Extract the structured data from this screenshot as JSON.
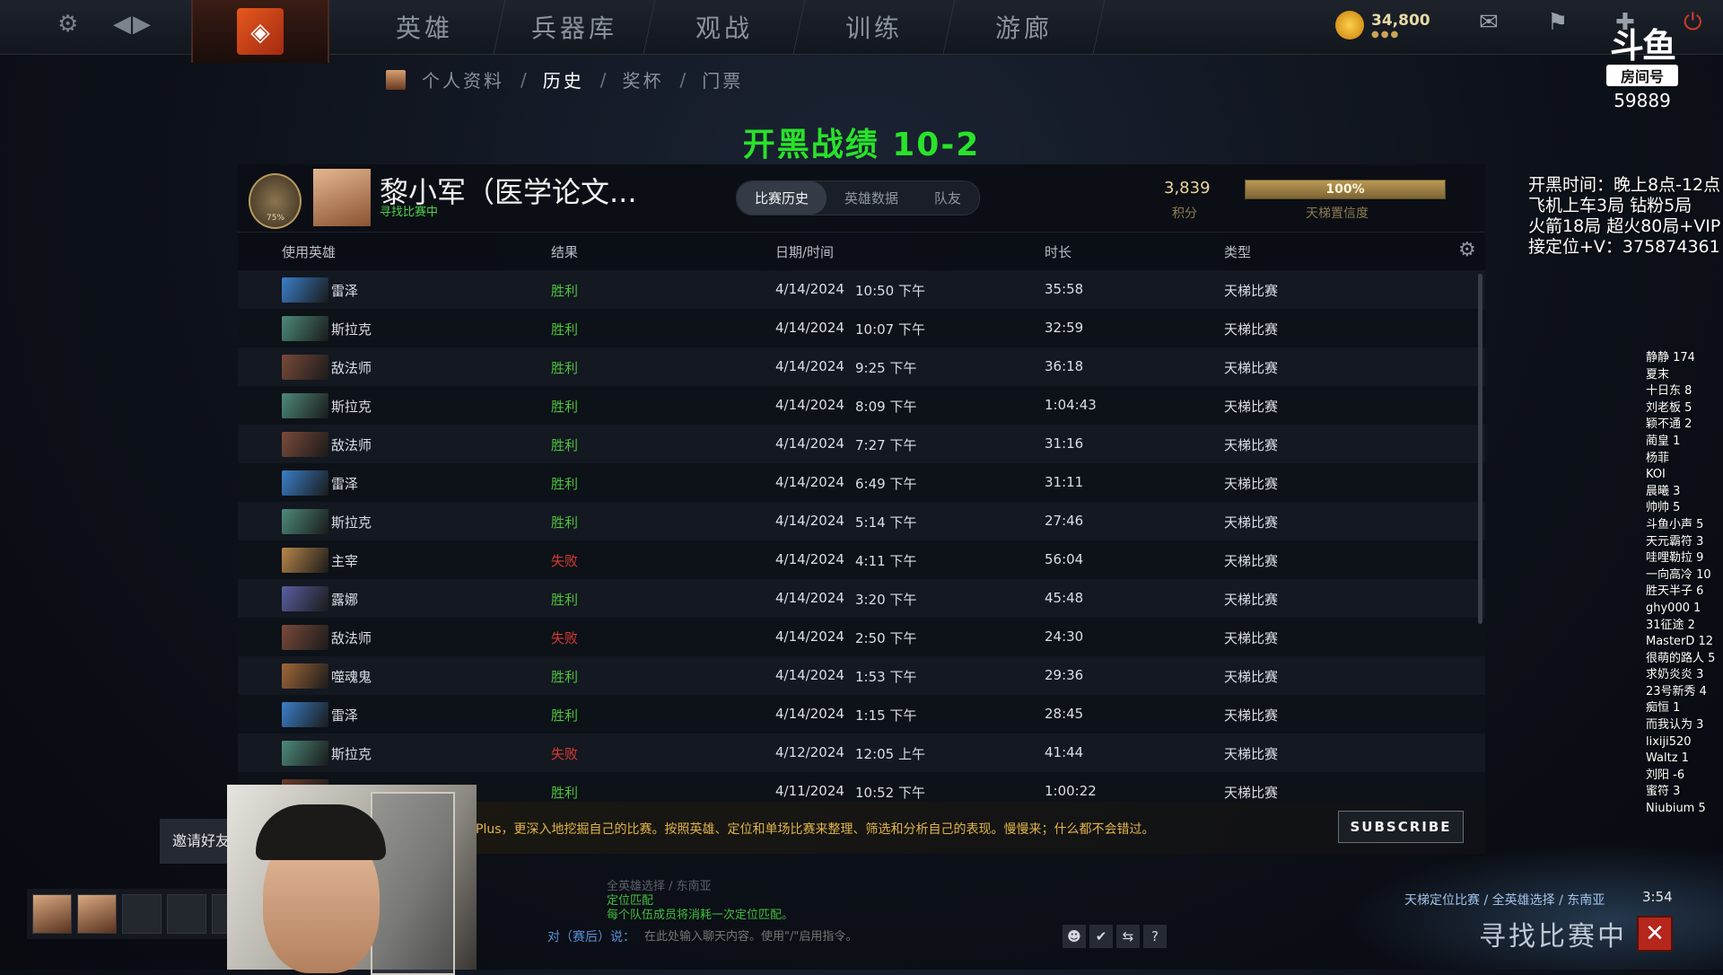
{
  "topbar": {
    "nav": [
      "英雄",
      "兵器库",
      "观战",
      "训练",
      "游廊"
    ],
    "coins": "34,800",
    "coins_dots": "●●●"
  },
  "breadcrumb": [
    {
      "label": "个人资料",
      "active": false
    },
    {
      "label": "历史",
      "active": true
    },
    {
      "label": "奖杯",
      "active": false
    },
    {
      "label": "门票",
      "active": false
    }
  ],
  "watermark": {
    "logo": "斗鱼",
    "box": "房间号",
    "number": "59889"
  },
  "headline": "开黑战绩 10-2",
  "profile": {
    "rank_pct": "75%",
    "name": "黎小军（医学论文...",
    "status": "寻找比赛中",
    "tabs": [
      {
        "label": "比赛历史",
        "active": true
      },
      {
        "label": "英雄数据",
        "active": false
      },
      {
        "label": "队友",
        "active": false
      }
    ],
    "mmr_value": "3,839",
    "mmr_label": "积分",
    "confidence_value": "100%",
    "confidence_fraction": 1.0,
    "confidence_label": "天梯置信度"
  },
  "table": {
    "headers": [
      "使用英雄",
      "结果",
      "日期/时间",
      "时长",
      "类型"
    ],
    "rows": [
      {
        "hero": "雷泽",
        "result": "胜利",
        "win": true,
        "date": "4/14/2024",
        "time": "10:50 下午",
        "duration": "35:58",
        "type": "天梯比赛",
        "color": "#3a7fc8"
      },
      {
        "hero": "斯拉克",
        "result": "胜利",
        "win": true,
        "date": "4/14/2024",
        "time": "10:07 下午",
        "duration": "32:59",
        "type": "天梯比赛",
        "color": "#4d8a7a"
      },
      {
        "hero": "敌法师",
        "result": "胜利",
        "win": true,
        "date": "4/14/2024",
        "time": "9:25 下午",
        "duration": "36:18",
        "type": "天梯比赛",
        "color": "#7a4a3a"
      },
      {
        "hero": "斯拉克",
        "result": "胜利",
        "win": true,
        "date": "4/14/2024",
        "time": "8:09 下午",
        "duration": "1:04:43",
        "type": "天梯比赛",
        "color": "#4d8a7a"
      },
      {
        "hero": "敌法师",
        "result": "胜利",
        "win": true,
        "date": "4/14/2024",
        "time": "7:27 下午",
        "duration": "31:16",
        "type": "天梯比赛",
        "color": "#7a4a3a"
      },
      {
        "hero": "雷泽",
        "result": "胜利",
        "win": true,
        "date": "4/14/2024",
        "time": "6:49 下午",
        "duration": "31:11",
        "type": "天梯比赛",
        "color": "#3a7fc8"
      },
      {
        "hero": "斯拉克",
        "result": "胜利",
        "win": true,
        "date": "4/14/2024",
        "time": "5:14 下午",
        "duration": "27:46",
        "type": "天梯比赛",
        "color": "#4d8a7a"
      },
      {
        "hero": "主宰",
        "result": "失败",
        "win": false,
        "date": "4/14/2024",
        "time": "4:11 下午",
        "duration": "56:04",
        "type": "天梯比赛",
        "color": "#b8864a"
      },
      {
        "hero": "露娜",
        "result": "胜利",
        "win": true,
        "date": "4/14/2024",
        "time": "3:20 下午",
        "duration": "45:48",
        "type": "天梯比赛",
        "color": "#5a5ea0"
      },
      {
        "hero": "敌法师",
        "result": "失败",
        "win": false,
        "date": "4/14/2024",
        "time": "2:50 下午",
        "duration": "24:30",
        "type": "天梯比赛",
        "color": "#7a4a3a"
      },
      {
        "hero": "噬魂鬼",
        "result": "胜利",
        "win": true,
        "date": "4/14/2024",
        "time": "1:53 下午",
        "duration": "29:36",
        "type": "天梯比赛",
        "color": "#a0683a"
      },
      {
        "hero": "雷泽",
        "result": "胜利",
        "win": true,
        "date": "4/14/2024",
        "time": "1:15 下午",
        "duration": "28:45",
        "type": "天梯比赛",
        "color": "#3a7fc8"
      },
      {
        "hero": "斯拉克",
        "result": "失败",
        "win": false,
        "date": "4/12/2024",
        "time": "12:05 上午",
        "duration": "41:44",
        "type": "天梯比赛",
        "color": "#4d8a7a"
      },
      {
        "hero": "",
        "result": "胜利",
        "win": true,
        "date": "4/11/2024",
        "time": "10:52 下午",
        "duration": "1:00:22",
        "type": "天梯比赛",
        "color": "#6a3a2a"
      }
    ]
  },
  "plus_banner": {
    "text": "Plus，更深入地挖掘自己的比赛。按照英雄、定位和单场比赛来整理、筛选和分析自己的表现。慢慢来；什么都不会错过。",
    "button": "SUBSCRIBE"
  },
  "overlay": {
    "info": [
      "开黑时间：晚上8点-12点",
      "飞机上车3局  钻粉5局",
      "火箭18局  超火80局+VIP",
      "接定位+V：375874361"
    ],
    "list": [
      "静静 174",
      "夏末",
      "十日东 8",
      "刘老板 5",
      "颖不通 2",
      "蔺皇 1",
      "杨菲",
      "KOI",
      "晨曦 3",
      "帅帅 5",
      "斗鱼小声 5",
      "天元霸符 3",
      "哇哩勒拉 9",
      "一向高冷 10",
      "胜天半子 6",
      "ghy000  1",
      "31征途  2",
      "MasterD 12",
      "很萌的路人 5",
      "求奶炎炎 3",
      "23号新秀 4",
      "痴恒 1",
      "而我认为 3",
      "lixiji520",
      "Waltz  1",
      "刘阳 -6",
      "蜜符 3",
      "Niubium 5"
    ]
  },
  "bottom": {
    "invite": "邀请好友",
    "chat_dim": "全英雄选择 / 东南亚",
    "chat_title": "定位匹配",
    "chat_desc": "每个队伍成员将消耗一次定位匹配。",
    "chat_target": "对（赛后）说：",
    "chat_placeholder": "在此处输入聊天内容。使用\"/\"启用指令。",
    "queue_modes": "天梯定位比赛 / 全英雄选择 / 东南亚",
    "queue_time": "3:54",
    "queue_status": "寻找比赛中",
    "chat_buttons": [
      "☻",
      "✔",
      "⇆",
      "?"
    ]
  },
  "colors": {
    "win": "#4fc33c",
    "loss": "#d63a2e",
    "headline": "#29e22a"
  },
  "icons": [
    "gear-icon",
    "back-icon",
    "forward-icon",
    "dota-logo-icon",
    "coin-icon",
    "mail-icon",
    "armory-icon",
    "plus-icon",
    "power-icon",
    "settings-icon",
    "close-icon"
  ]
}
